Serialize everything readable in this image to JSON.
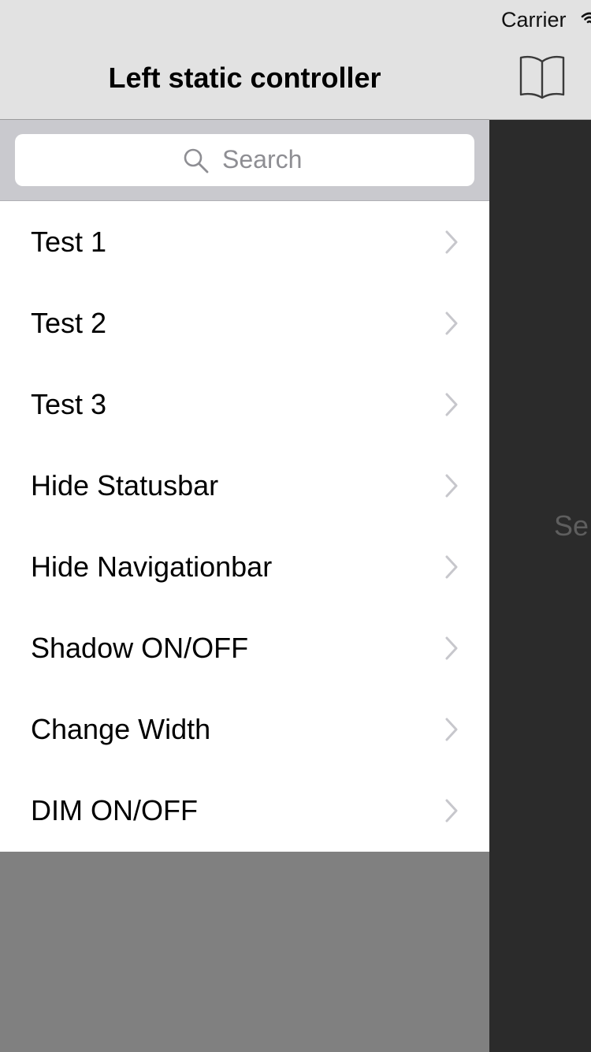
{
  "status_bar": {
    "carrier": "Carrier"
  },
  "left_panel": {
    "title": "Left static controller",
    "search": {
      "placeholder": "Search"
    },
    "items": [
      {
        "label": "Test 1"
      },
      {
        "label": "Test 2"
      },
      {
        "label": "Test 3"
      },
      {
        "label": "Hide Statusbar"
      },
      {
        "label": "Hide Navigationbar"
      },
      {
        "label": "Shadow ON/OFF"
      },
      {
        "label": "Change Width"
      },
      {
        "label": "DIM ON/OFF"
      }
    ]
  },
  "main": {
    "hint_text": "Se"
  },
  "icons": {
    "navbar": "book-icon",
    "search": "search-icon",
    "row_accessory": "chevron-right-icon",
    "status": "wifi-icon"
  },
  "colors": {
    "nav_background": "#e2e2e2",
    "search_bar_background": "#c9c9ce",
    "main_background": "#2b2b2b",
    "panel_background": "#808080",
    "chevron": "#c7c7cc",
    "placeholder": "#8e8e93"
  }
}
